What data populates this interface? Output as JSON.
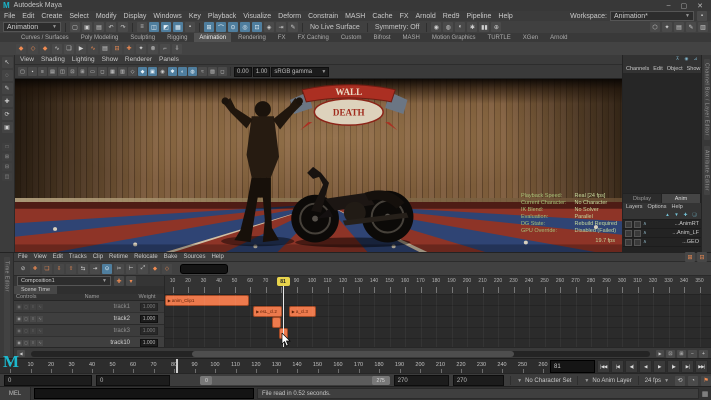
{
  "titlebar": {
    "title": "Autodesk Maya"
  },
  "window_buttons": [
    {
      "n": "minimize-button",
      "g": "–"
    },
    {
      "n": "maximize-button",
      "g": "▢"
    },
    {
      "n": "close-button",
      "g": "✕"
    }
  ],
  "menubar": {
    "menus": [
      "File",
      "Edit",
      "Create",
      "Select",
      "Modify",
      "Display",
      "Windows",
      "Key",
      "Playback",
      "Visualize",
      "Deform",
      "Constrain",
      "MASH",
      "Cache",
      "FX",
      "Arnold",
      "Red9",
      "Pipeline",
      "Help"
    ],
    "workspace_label": "Workspace:",
    "workspace_value": "Animation*"
  },
  "statusline": {
    "menuset": "Animation",
    "no_live_surface": "No Live Surface",
    "symmetry": "Symmetry: Off",
    "file_icons": [
      {
        "n": "new-scene-icon",
        "g": "▢"
      },
      {
        "n": "open-scene-icon",
        "g": "▣"
      },
      {
        "n": "save-scene-icon",
        "g": "▤"
      },
      {
        "n": "undo-icon",
        "g": "↶"
      },
      {
        "n": "redo-icon",
        "g": "↷"
      }
    ],
    "mask_icons": [
      {
        "n": "select-hierarchy-icon",
        "g": "≡"
      },
      {
        "n": "select-object-icon",
        "g": "◫",
        "cls": "hl"
      },
      {
        "n": "select-component-icon",
        "g": "◩",
        "cls": "hl"
      },
      {
        "n": "select-by-type-icon",
        "g": "▦",
        "cls": "hl"
      },
      {
        "n": "lock-selection-icon",
        "g": "▪"
      }
    ],
    "snap_icons": [
      {
        "n": "snap-to-grid-icon",
        "g": "⊞",
        "cls": "hl"
      },
      {
        "n": "snap-to-curve-icon",
        "g": "⌒",
        "cls": "hl"
      },
      {
        "n": "snap-to-point-icon",
        "g": "⊙",
        "cls": "hl"
      },
      {
        "n": "snap-to-projected-center-icon",
        "g": "◎",
        "cls": "hl"
      },
      {
        "n": "snap-to-view-plane-icon",
        "g": "⊡",
        "cls": "hl"
      },
      {
        "n": "make-live-icon",
        "g": "◈"
      },
      {
        "n": "input-operations-icon",
        "g": "⇥"
      },
      {
        "n": "construction-history-icon",
        "g": "✎"
      }
    ],
    "render_icons": [
      {
        "n": "open-render-view-icon",
        "g": "◉"
      },
      {
        "n": "render-current-frame-icon",
        "g": "◍"
      },
      {
        "n": "ipr-render-icon",
        "g": "◐"
      },
      {
        "n": "render-settings-icon",
        "g": "✱"
      },
      {
        "n": "pause-viewport-icon",
        "g": "▮▮"
      },
      {
        "n": "evaluation-icon",
        "g": "⊕"
      }
    ],
    "right_icons": [
      {
        "n": "modeling-toolkit-icon",
        "g": "⬡"
      },
      {
        "n": "humanik-icon",
        "g": "✦"
      },
      {
        "n": "attribute-editor-icon",
        "g": "▤"
      },
      {
        "n": "tool-settings-icon",
        "g": "✎"
      },
      {
        "n": "channel-box-icon",
        "g": "▥"
      }
    ]
  },
  "shelf": {
    "tabs": [
      "Curves / Surfaces",
      "Poly Modeling",
      "Sculpting",
      "Rigging",
      "Animation",
      "Rendering",
      "FX",
      "FX Caching",
      "Custom",
      "Bifrost",
      "MASH",
      "Motion Graphics",
      "TURTLE",
      "XGen",
      "Arnold"
    ],
    "active": "Animation",
    "icons": [
      {
        "n": "set-key-icon",
        "g": "◆",
        "cls": "o"
      },
      {
        "n": "set-breakdown-icon",
        "g": "◇",
        "cls": "o"
      },
      {
        "n": "set-driven-key-icon",
        "g": "◆",
        "cls": "o"
      },
      {
        "n": "motion-trail-icon",
        "g": "∿"
      },
      {
        "n": "ghost-icon",
        "g": "❏"
      },
      {
        "n": "playblast-icon",
        "g": "▶"
      },
      {
        "n": "graph-editor-icon",
        "g": "∿",
        "cls": "o"
      },
      {
        "n": "dope-sheet-icon",
        "g": "▤"
      },
      {
        "n": "time-editor-icon",
        "g": "⊟",
        "cls": "o"
      },
      {
        "n": "create-clip-icon",
        "g": "✚",
        "cls": "o"
      },
      {
        "n": "hik-character-icon",
        "g": "✦"
      },
      {
        "n": "constraint-icon",
        "g": "⊗"
      },
      {
        "n": "ik-handle-icon",
        "g": "⌐"
      },
      {
        "n": "bake-anim-icon",
        "g": "⇩"
      }
    ]
  },
  "toolbox": {
    "tools": [
      {
        "n": "select-tool-icon",
        "g": "↖"
      },
      {
        "n": "lasso-tool-icon",
        "g": "◌"
      },
      {
        "n": "paint-select-tool-icon",
        "g": "✎"
      },
      {
        "n": "move-tool-icon",
        "g": "✚"
      },
      {
        "n": "rotate-tool-icon",
        "g": "⟳"
      },
      {
        "n": "scale-tool-icon",
        "g": "▣"
      }
    ],
    "layouts": [
      {
        "n": "layout-single-pane-icon",
        "g": "□"
      },
      {
        "n": "layout-four-pane-icon",
        "g": "⊞"
      },
      {
        "n": "layout-two-pane-stacked-icon",
        "g": "⊟"
      },
      {
        "n": "layout-two-pane-side-icon",
        "g": "◫"
      }
    ]
  },
  "viewport": {
    "menus": [
      "View",
      "Shading",
      "Lighting",
      "Show",
      "Renderer",
      "Panels"
    ],
    "toolbar_icons": [
      {
        "n": "select-camera-icon",
        "g": "▢"
      },
      {
        "n": "lock-camera-icon",
        "g": "▪"
      },
      {
        "n": "camera-attributes-icon",
        "g": "≡"
      },
      {
        "n": "bookmarks-icon",
        "g": "▤"
      },
      {
        "n": "image-plane-icon",
        "g": "◫"
      },
      {
        "n": "2d-pan-zoom-icon",
        "g": "⊡"
      },
      {
        "n": "grid-icon",
        "g": "⊞"
      },
      {
        "n": "film-gate-icon",
        "g": "▭"
      },
      {
        "n": "resolution-gate-icon",
        "g": "◻"
      },
      {
        "n": "gate-mask-icon",
        "g": "▦"
      },
      {
        "n": "field-chart-icon",
        "g": "▥"
      },
      {
        "n": "wireframe-icon",
        "g": "◇"
      },
      {
        "n": "shaded-icon",
        "g": "◆",
        "cls": "hl"
      },
      {
        "n": "textured-icon",
        "g": "▣",
        "cls": "hl"
      },
      {
        "n": "use-default-material-icon",
        "g": "◉"
      },
      {
        "n": "lighting-icon",
        "g": "✱",
        "cls": "hl"
      },
      {
        "n": "shadows-icon",
        "g": "◐",
        "cls": "hl"
      },
      {
        "n": "screen-space-ao-icon",
        "g": "◍",
        "cls": "hl"
      },
      {
        "n": "motion-blur-icon",
        "g": "≈"
      },
      {
        "n": "multisample-icon",
        "g": "▨"
      },
      {
        "n": "xray-icon",
        "g": "◻"
      }
    ],
    "exposure": "0.00",
    "gamma": "1.00",
    "color_mode": "sRGB gamma",
    "scene": {
      "banner_top": "WALL",
      "banner_bottom": "DEATH"
    },
    "hud": {
      "rows": [
        {
          "l": "Playback Speed:",
          "v": "Real [24 fps]"
        },
        {
          "l": "Current Character:",
          "v": "No Character"
        },
        {
          "l": "IK Blend:",
          "v": "No Solver"
        },
        {
          "l": "Evaluation:",
          "v": "Parallel"
        },
        {
          "l": "DG State:",
          "v": "Rebuild Required"
        },
        {
          "l": "GPU Override:",
          "v": "Disabled (Failed)"
        }
      ],
      "fps": "19.7 fps"
    }
  },
  "channel_box": {
    "menus": [
      "Channels",
      "Edit",
      "Object",
      "Show"
    ],
    "corner_icons": [
      {
        "n": "pin-channel-box-icon",
        "g": "⊼"
      },
      {
        "n": "channel-box-manip-icon",
        "g": "◉"
      },
      {
        "n": "channel-box-speed-icon",
        "g": "⊿"
      }
    ]
  },
  "layer_editor": {
    "tabs": [
      "Display",
      "Anim"
    ],
    "active_tab": "Anim",
    "menus": [
      "Layers",
      "Options",
      "Help"
    ],
    "icons": [
      {
        "n": "move-layer-up-icon",
        "g": "▲"
      },
      {
        "n": "move-layer-down-icon",
        "g": "▼"
      },
      {
        "n": "empty-anim-layer-icon",
        "g": "✚"
      },
      {
        "n": "anim-layer-from-selected-icon",
        "g": "❏"
      }
    ],
    "layers": [
      "...AnimRT",
      "...Anim_LF",
      "...GEO"
    ]
  },
  "side_tabs": [
    "Channel Box / Layer Editor",
    "Attribute Editor"
  ],
  "time_editor": {
    "panel_tab": "Time Editor",
    "menus": [
      "File",
      "View",
      "Edit",
      "Tracks",
      "Clip",
      "Retime",
      "Relocate",
      "Bake",
      "Sources",
      "Help"
    ],
    "menu_right_icons": [
      {
        "n": "te-dock-icon",
        "g": "⊞",
        "cls": "o"
      },
      {
        "n": "te-layout-icon",
        "g": "⊟",
        "cls": "o"
      }
    ],
    "toolbar_icons": [
      {
        "n": "te-mute-all-icon",
        "g": "⊘",
        "cls": "flat"
      },
      {
        "n": "te-add-clip-icon",
        "g": "✚",
        "cls": "o"
      },
      {
        "n": "te-add-group-icon",
        "g": "❏",
        "cls": "o"
      },
      {
        "n": "te-import-anim-icon",
        "g": "⇩",
        "cls": "o"
      },
      {
        "n": "te-export-anim-icon",
        "g": "⇧",
        "cls": "o"
      },
      {
        "n": "te-ripple-edit-icon",
        "g": "⇆"
      },
      {
        "n": "te-insert-mode-icon",
        "g": "⇥"
      },
      {
        "n": "te-snap-toggle-icon",
        "g": "⊙",
        "cls": "hl"
      },
      {
        "n": "te-split-clip-icon",
        "g": "✂"
      },
      {
        "n": "te-trim-clip-icon",
        "g": "⊢"
      },
      {
        "n": "te-scale-clip-icon",
        "g": "⤢"
      },
      {
        "n": "te-set-key-icon",
        "g": "◆",
        "cls": "o"
      },
      {
        "n": "te-zero-key-icon",
        "g": "◇",
        "cls": "o"
      }
    ],
    "composition": "Composition1",
    "comp_icons": [
      {
        "n": "add-composition-icon",
        "g": "✚",
        "cls": "o"
      },
      {
        "n": "composition-options-icon",
        "g": "▾",
        "cls": "o"
      }
    ],
    "time_tab": "Scene Time",
    "columns": [
      "Controls",
      "Name",
      "Weight"
    ],
    "tracks": [
      {
        "name": "track1",
        "weight": "1.000",
        "dim": true,
        "clips": [
          {
            "label": "anim_Clip1",
            "start": 5,
            "end": 57
          }
        ]
      },
      {
        "name": "track2",
        "weight": "1.000",
        "dim": false,
        "clips": [
          {
            "label": "esL_cl.2",
            "start": 62,
            "end": 78
          },
          {
            "label": "a_cl.3",
            "start": 85,
            "end": 100
          }
        ]
      },
      {
        "name": "track3",
        "weight": "1.000",
        "dim": true,
        "clips": [
          {
            "label": "",
            "start": 74,
            "end": 77
          }
        ]
      },
      {
        "name": "track10",
        "weight": "1.000",
        "dim": false,
        "clips": [
          {
            "label": "",
            "start": 79,
            "end": 82
          }
        ]
      }
    ],
    "ruler": {
      "start": 10,
      "end": 350,
      "step": 10
    },
    "playhead": {
      "frame": 81,
      "label": "81"
    },
    "footer_icons": [
      {
        "n": "te-frame-all-icon",
        "g": "⊡"
      },
      {
        "n": "te-frame-playback-icon",
        "g": "⊞"
      },
      {
        "n": "te-zoom-out-icon",
        "g": "−"
      },
      {
        "n": "te-zoom-in-icon",
        "g": "+"
      }
    ]
  },
  "time_slider": {
    "start": 0,
    "end": 270,
    "step": 10,
    "current_frame": 81,
    "current_label": "81"
  },
  "transport": [
    {
      "n": "go-to-start-button",
      "g": "|◀◀"
    },
    {
      "n": "step-back-frame-button",
      "g": "|◀"
    },
    {
      "n": "step-back-key-button",
      "g": "◀|"
    },
    {
      "n": "play-backwards-button",
      "g": "◀"
    },
    {
      "n": "play-forward-button",
      "g": "▶"
    },
    {
      "n": "step-forward-key-button",
      "g": "|▶"
    },
    {
      "n": "step-forward-frame-button",
      "g": "▶|"
    },
    {
      "n": "go-to-end-button",
      "g": "▶▶|"
    }
  ],
  "range_slider": {
    "left_fields": [
      "0",
      "0"
    ],
    "bar_start_label": "0",
    "bar_end_label": "275",
    "right_fields": [
      "270",
      "270"
    ]
  },
  "playback_options": {
    "character_set": "No Character Set",
    "anim_layer": "No Anim Layer",
    "fps": "24 fps",
    "icons": [
      {
        "n": "playback-speed-icon",
        "g": "⟲"
      },
      {
        "n": "anim-preferences-icon",
        "g": "◔"
      },
      {
        "n": "auto-key-icon",
        "g": "⚑",
        "cls": "o"
      }
    ]
  },
  "command_line": {
    "label": "MEL",
    "help_text": "File read in 0.52 seconds."
  }
}
